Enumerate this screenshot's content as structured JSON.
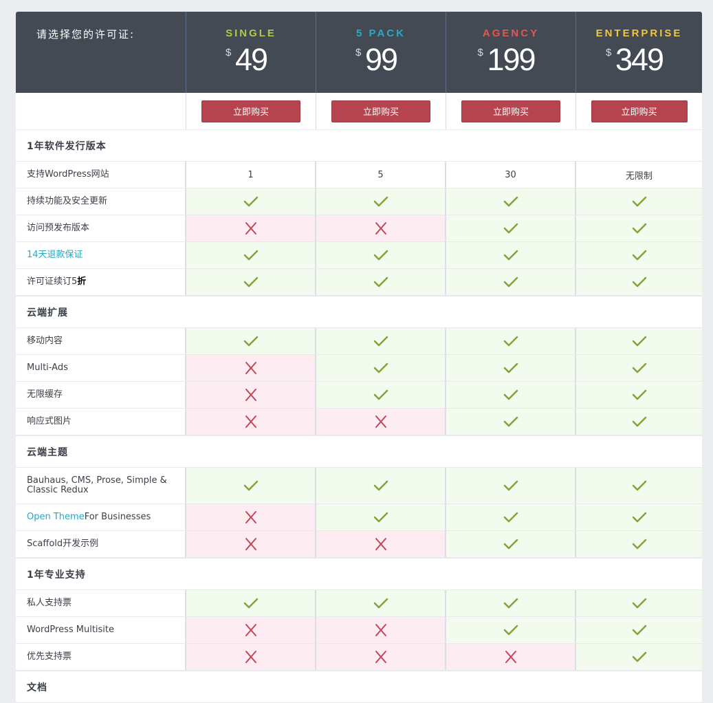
{
  "header": {
    "label": "请选择您的许可证:",
    "plans": [
      {
        "name": "SINGLE",
        "currency": "$",
        "price": "49",
        "color": "#b6c64a"
      },
      {
        "name": "5 PACK",
        "currency": "$",
        "price": "99",
        "color": "#29a9c8"
      },
      {
        "name": "AGENCY",
        "currency": "$",
        "price": "199",
        "color": "#e5564f"
      },
      {
        "name": "ENTERPRISE",
        "currency": "$",
        "price": "349",
        "color": "#f1c63d"
      }
    ]
  },
  "buy_label": "立即购买",
  "colors": {
    "check": "#86a23a",
    "cross": "#c0475a",
    "button": "#b5444f",
    "header_bg": "#444a53"
  },
  "sections": [
    {
      "title": "1年软件发行版本",
      "rows": [
        {
          "type": "values",
          "label": "支持WordPress网站",
          "values": [
            "1",
            "5",
            "30",
            "无限制"
          ]
        },
        {
          "label": "持续功能及安全更新",
          "marks": [
            "yes",
            "yes",
            "yes",
            "yes"
          ]
        },
        {
          "label": "访问预发布版本",
          "marks": [
            "no",
            "no",
            "yes",
            "yes"
          ]
        },
        {
          "label": "14天退款保证",
          "link": true,
          "marks": [
            "yes",
            "yes",
            "yes",
            "yes"
          ]
        },
        {
          "label_parts": [
            "许可证续订5",
            "折"
          ],
          "marks": [
            "yes",
            "yes",
            "yes",
            "yes"
          ]
        }
      ]
    },
    {
      "title": "云端扩展",
      "rows": [
        {
          "label": "移动内容",
          "marks": [
            "yes",
            "yes",
            "yes",
            "yes"
          ]
        },
        {
          "label": "Multi-Ads",
          "marks": [
            "no",
            "yes",
            "yes",
            "yes"
          ]
        },
        {
          "label": "无限缓存",
          "marks": [
            "no",
            "yes",
            "yes",
            "yes"
          ]
        },
        {
          "label": "响应式图片",
          "marks": [
            "no",
            "no",
            "yes",
            "yes"
          ]
        }
      ]
    },
    {
      "title": "云端主题",
      "rows": [
        {
          "label_lines": [
            "Bauhaus, CMS, Prose, Simple &",
            "Classic Redux"
          ],
          "tall": true,
          "marks": [
            "yes",
            "yes",
            "yes",
            "yes"
          ]
        },
        {
          "label_link_parts": [
            "Open Theme",
            " For Businesses"
          ],
          "marks": [
            "no",
            "yes",
            "yes",
            "yes"
          ]
        },
        {
          "label": "Scaffold开发示例",
          "marks": [
            "no",
            "no",
            "yes",
            "yes"
          ]
        }
      ]
    },
    {
      "title": "1年专业支持",
      "rows": [
        {
          "label": "私人支持票",
          "marks": [
            "yes",
            "yes",
            "yes",
            "yes"
          ]
        },
        {
          "label": "WordPress Multisite",
          "marks": [
            "no",
            "no",
            "yes",
            "yes"
          ]
        },
        {
          "label": "优先支持票",
          "marks": [
            "no",
            "no",
            "no",
            "yes"
          ]
        }
      ]
    },
    {
      "title": "文档",
      "rows": []
    }
  ]
}
